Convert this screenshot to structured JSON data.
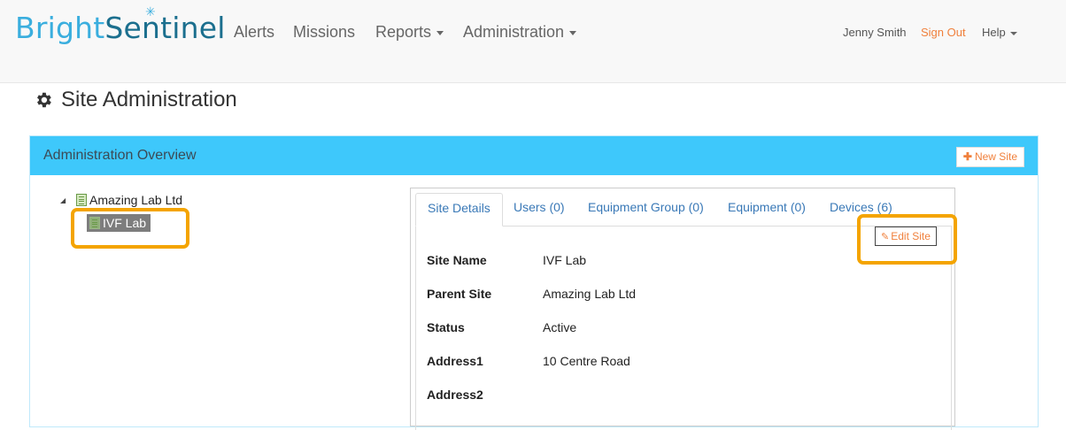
{
  "brand": {
    "part1": "Bright",
    "part2": "Sentinel"
  },
  "nav": {
    "alerts": "Alerts",
    "missions": "Missions",
    "reports": "Reports",
    "administration": "Administration"
  },
  "user": {
    "name": "Jenny Smith",
    "sign_out": "Sign Out",
    "help": "Help"
  },
  "page": {
    "title": "Site Administration"
  },
  "panel": {
    "title": "Administration Overview",
    "new_site_label": "New Site"
  },
  "tree": {
    "root": {
      "label": "Amazing Lab Ltd"
    },
    "child": {
      "label": "IVF Lab",
      "selected": true
    }
  },
  "tabs": [
    {
      "label": "Site Details",
      "active": true
    },
    {
      "label": "Users (0)"
    },
    {
      "label": "Equipment Group (0)"
    },
    {
      "label": "Equipment (0)"
    },
    {
      "label": "Devices (6)"
    }
  ],
  "edit_site_label": "Edit Site",
  "site_details": [
    {
      "label": "Site Name",
      "value": "IVF Lab"
    },
    {
      "label": "Parent Site",
      "value": "Amazing Lab Ltd"
    },
    {
      "label": "Status",
      "value": "Active"
    },
    {
      "label": "Address1",
      "value": "10 Centre Road"
    },
    {
      "label": "Address2",
      "value": ""
    }
  ],
  "colors": {
    "brand_light": "#3aaede",
    "brand_dark": "#1b6f8e",
    "panel_header": "#3ec8fb",
    "accent_orange": "#f0803c",
    "highlight_box": "#f4a400",
    "link_blue": "#3a79b7"
  }
}
